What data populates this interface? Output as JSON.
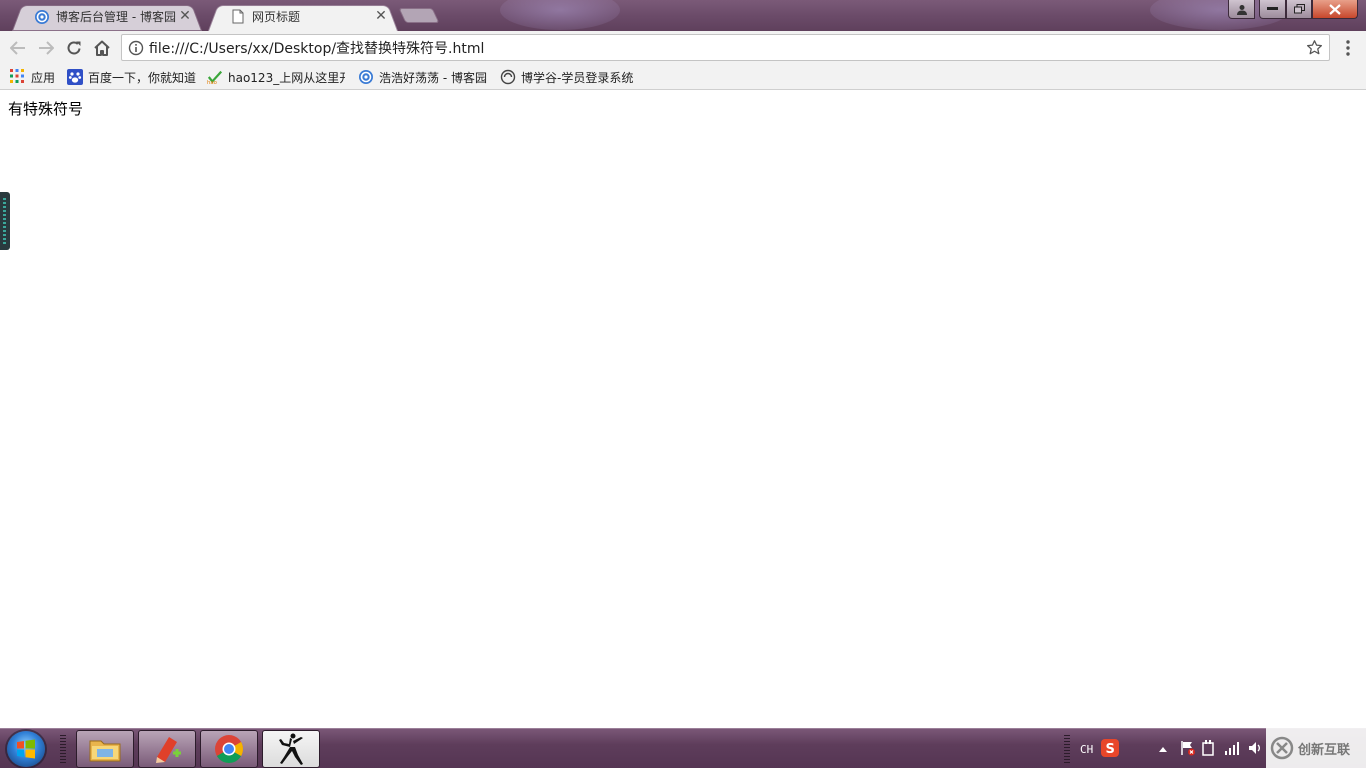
{
  "window": {
    "tabs": [
      {
        "title": "博客后台管理 - 博客园",
        "icon": "cnblogs-icon",
        "active": false
      },
      {
        "title": "网页标题",
        "icon": "page-icon",
        "active": true
      }
    ],
    "controls": [
      "user-icon",
      "minimize-icon",
      "restore-icon",
      "close-icon"
    ]
  },
  "toolbar": {
    "url": "file:///C:/Users/xx/Desktop/查找替换特殊符号.html"
  },
  "bookmarks": [
    {
      "label": "应用",
      "icon": "apps-grid-icon"
    },
    {
      "label": "百度一下，你就知道",
      "icon": "baidu-paw-icon"
    },
    {
      "label": "hao123_上网从这里开",
      "icon": "hao123-icon"
    },
    {
      "label": "浩浩好荡荡 - 博客园",
      "icon": "cnblogs-icon"
    },
    {
      "label": "博学谷-学员登录系统",
      "icon": "boxuegu-icon"
    }
  ],
  "page": {
    "body_text": "有特殊符号"
  },
  "taskbar": {
    "apps": [
      "file-explorer-icon",
      "notes-app-icon",
      "chrome-icon",
      "jordan-jumpman-icon"
    ],
    "tray": {
      "language": "CH",
      "icons": [
        "sogou-ime-icon",
        "show-hidden-icons-arrow",
        "action-center-flag-icon",
        "power-icon",
        "network-signal-icon",
        "volume-icon"
      ]
    }
  },
  "watermark": {
    "text": "创新互联"
  },
  "colors": {
    "titlebar": "#6a4a68",
    "taskbar": "#5e3d5b",
    "toolbar": "#f2f2f2",
    "chrome_red": "#db4437",
    "chrome_green": "#0f9d58",
    "chrome_yellow": "#f4b400",
    "chrome_blue": "#4285f4"
  }
}
